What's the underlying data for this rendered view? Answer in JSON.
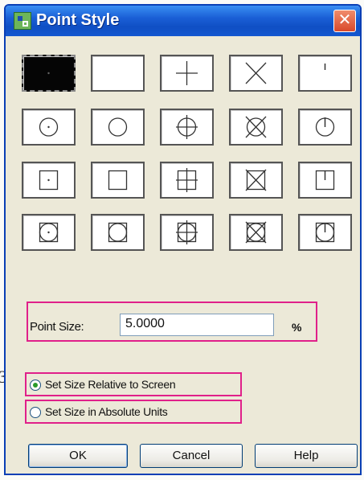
{
  "window": {
    "title": "Point Style",
    "close_label": "✕"
  },
  "point_styles": {
    "selected": "dot",
    "rows": [
      [
        "dot",
        "none",
        "plus",
        "cross",
        "tick"
      ],
      [
        "circle-dot",
        "circle",
        "circle-plus",
        "circle-cross",
        "circle-tick"
      ],
      [
        "square-dot",
        "square",
        "square-plus",
        "square-cross",
        "square-tick"
      ],
      [
        "circle-square-dot",
        "circle-square",
        "circle-square-plus",
        "circle-square-cross",
        "circle-square-tick"
      ]
    ]
  },
  "point_size": {
    "label": "Point Size:",
    "value": "5.0000",
    "unit": "%"
  },
  "size_mode": {
    "options": [
      {
        "label": "Set Size Relative to Screen",
        "checked": true
      },
      {
        "label": "Set Size in Absolute Units",
        "checked": false
      }
    ]
  },
  "buttons": {
    "ok": "OK",
    "cancel": "Cancel",
    "help": "Help"
  },
  "page_marks": {
    "left_glyph": "3"
  },
  "colors": {
    "highlight": "#e0208a",
    "titlebar": "#0f4fc4",
    "dialog_bg": "#ece9d8"
  }
}
